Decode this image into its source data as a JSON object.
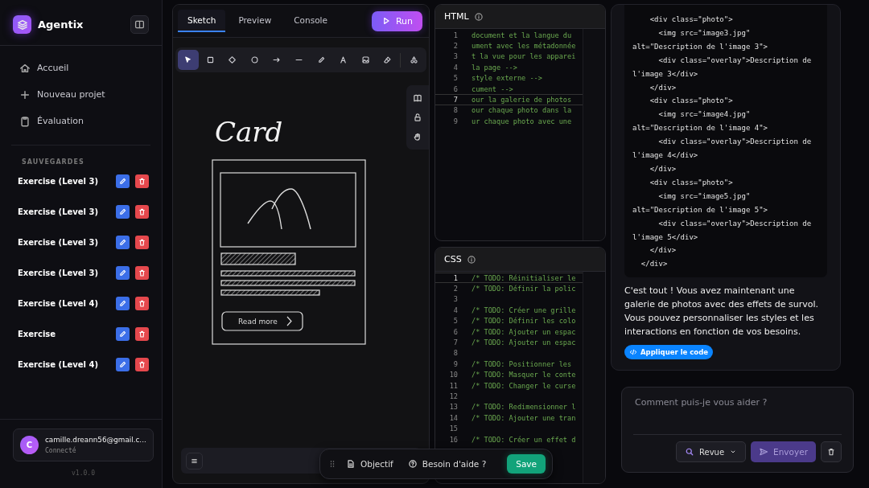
{
  "sidebar": {
    "brand": "Agentix",
    "nav": [
      {
        "label": "Accueil"
      },
      {
        "label": "Nouveau projet"
      },
      {
        "label": "Évaluation"
      }
    ],
    "saves_heading": "SAUVEGARDES",
    "saves": [
      {
        "label": "Exercise (Level 3)"
      },
      {
        "label": "Exercise (Level 3)"
      },
      {
        "label": "Exercise (Level 3)"
      },
      {
        "label": "Exercise (Level 3)"
      },
      {
        "label": "Exercise (Level 4)"
      },
      {
        "label": "Exercise"
      },
      {
        "label": "Exercise (Level 4)"
      }
    ],
    "user": {
      "initial": "C",
      "email": "camille.dreann56@gmail.c...",
      "status": "Connecté"
    },
    "version": "v1.0.0"
  },
  "sketch": {
    "tabs": [
      {
        "label": "Sketch",
        "selected": true
      },
      {
        "label": "Preview",
        "selected": false
      },
      {
        "label": "Console",
        "selected": false
      }
    ],
    "run_button": "Run",
    "tools": [
      {
        "selected": true
      },
      {
        "selected": false
      },
      {
        "selected": false
      },
      {
        "selected": false
      },
      {
        "selected": false
      },
      {
        "selected": false
      },
      {
        "selected": false
      },
      {
        "selected": false
      },
      {
        "selected": false
      },
      {
        "selected": false
      },
      {
        "selected": false
      }
    ],
    "canvas": {
      "title": "Card",
      "button_label": "Read more"
    }
  },
  "floating_bar": {
    "objective": "Objectif",
    "help": "Besoin d'aide ?",
    "save": "Save"
  },
  "html_editor": {
    "title": "HTML",
    "lines": [
      {
        "number": "1",
        "text": "document et la langue du",
        "current": false
      },
      {
        "number": "2",
        "text": "ument avec les métadonnée",
        "current": false
      },
      {
        "number": "3",
        "text": "t la vue pour les apparei",
        "current": false
      },
      {
        "number": "4",
        "text": "la page -->",
        "current": false
      },
      {
        "number": "5",
        "text": "style externe -->",
        "current": false
      },
      {
        "number": "6",
        "text": "cument -->",
        "current": false
      },
      {
        "number": "7",
        "text": "our la galerie de photos",
        "current": true
      },
      {
        "number": "8",
        "text": "our chaque photo dans la",
        "current": false
      },
      {
        "number": "9",
        "text": "ur chaque photo avec une",
        "current": false
      }
    ]
  },
  "css_editor": {
    "title": "CSS",
    "lines": [
      {
        "number": "1",
        "text": "/* TODO: Réinitialiser le",
        "current": true
      },
      {
        "number": "2",
        "text": "/* TODO: Définir la polic",
        "current": false
      },
      {
        "number": "3",
        "current": false
      },
      {
        "number": "4",
        "text": "/* TODO: Créer une grille",
        "current": false
      },
      {
        "number": "5",
        "text": "/* TODO: Définir les colo",
        "current": false
      },
      {
        "number": "6",
        "text": "/* TODO: Ajouter un espac",
        "current": false
      },
      {
        "number": "7",
        "text": "/* TODO: Ajouter un espac",
        "current": false
      },
      {
        "number": "8",
        "current": false
      },
      {
        "number": "9",
        "text": "/* TODO: Positionner les",
        "current": false
      },
      {
        "number": "10",
        "text": "/* TODO: Masquer le conte",
        "current": false
      },
      {
        "number": "11",
        "text": "/* TODO: Changer le curse",
        "current": false
      },
      {
        "number": "12",
        "current": false
      },
      {
        "number": "13",
        "text": "/* TODO: Redimensionner l",
        "current": false
      },
      {
        "number": "14",
        "text": "/* TODO: Ajouter une tran",
        "current": false
      },
      {
        "number": "15",
        "current": false
      },
      {
        "number": "16",
        "text": "/* TODO: Créer un effet d",
        "current": false
      }
    ]
  },
  "chat": {
    "code_lines": [
      "    <div class=\"photo\">",
      "      <img src=\"image3.jpg\"",
      "alt=\"Description de l'image 3\">",
      "      <div class=\"overlay\">Description de",
      "l'image 3</div>",
      "    </div>",
      "    <div class=\"photo\">",
      "      <img src=\"image4.jpg\"",
      "alt=\"Description de l'image 4\">",
      "      <div class=\"overlay\">Description de",
      "l'image 4</div>",
      "    </div>",
      "    <div class=\"photo\">",
      "      <img src=\"image5.jpg\"",
      "alt=\"Description de l'image 5\">",
      "      <div class=\"overlay\">Description de",
      "l'image 5</div>",
      "    </div>",
      "  </div>"
    ],
    "message": "C'est tout ! Vous avez maintenant une galerie de photos avec des effets de survol. Vous pouvez personnaliser les styles et les interactions en fonction de vos besoins.",
    "apply_button": "Appliquer le code",
    "input": {
      "placeholder": "Comment puis-je vous aider ?"
    },
    "mode": "Revue",
    "send_button": "Envoyer"
  }
}
